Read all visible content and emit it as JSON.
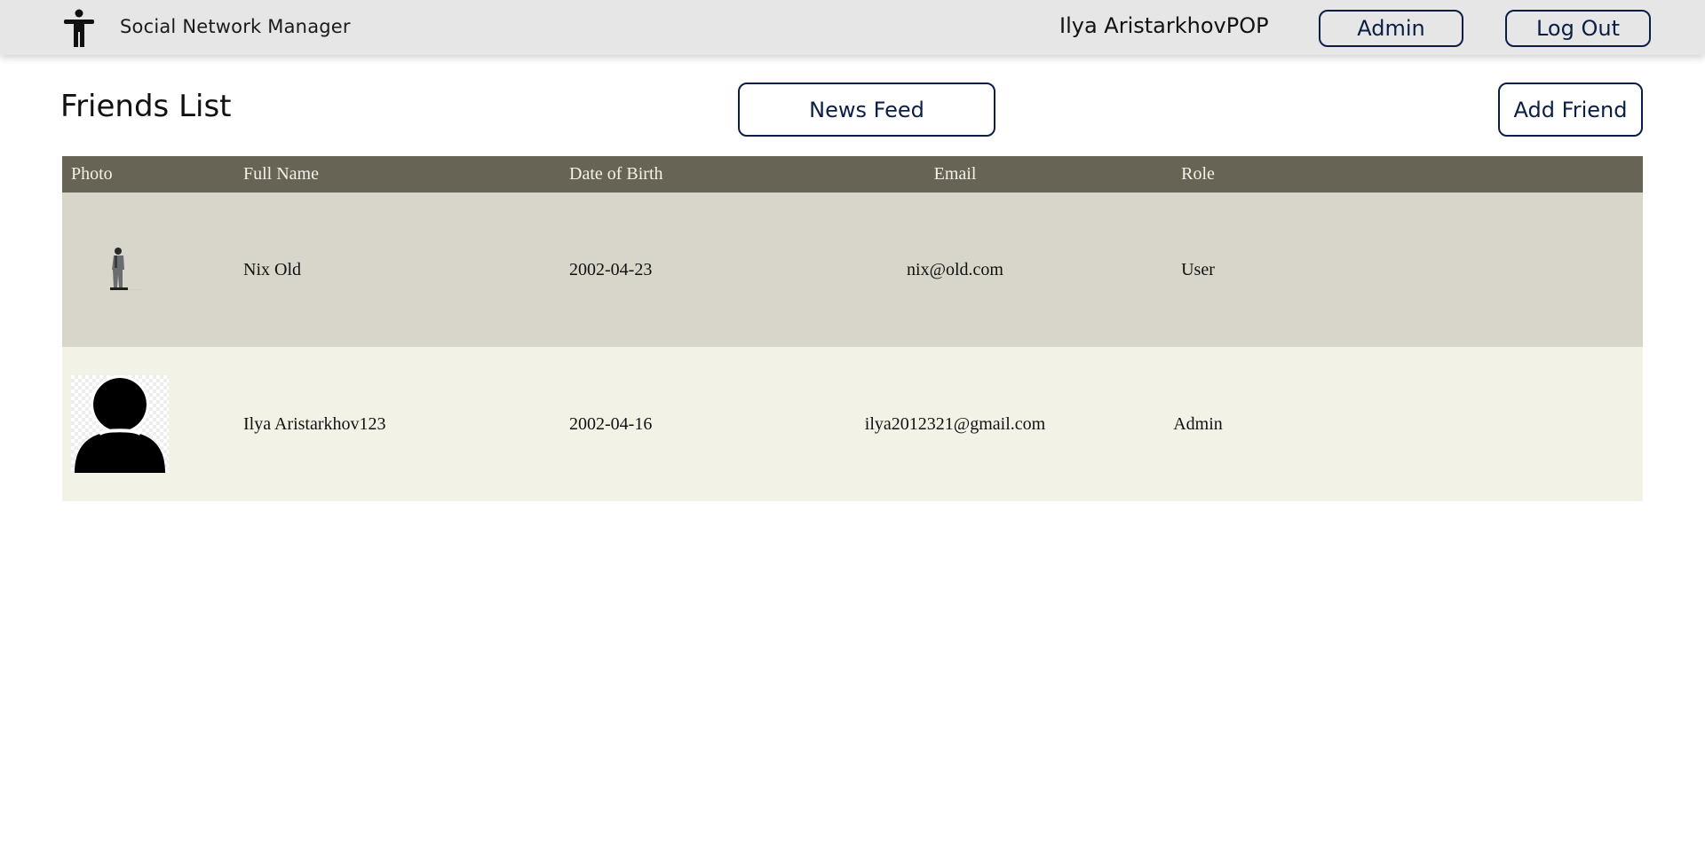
{
  "header": {
    "brand_title": "Social Network Manager",
    "brand_icon": "accessibility-person-icon",
    "user_name": "Ilya AristarkhovPOP",
    "admin_label": "Admin",
    "logout_label": "Log Out"
  },
  "page": {
    "title": "Friends List",
    "news_feed_label": "News Feed",
    "add_friend_label": "Add Friend"
  },
  "table": {
    "columns": [
      "Photo",
      "Full Name",
      "Date of Birth",
      "Email",
      "Role"
    ],
    "rows": [
      {
        "photo": "man-walking-photo",
        "full_name": "Nix Old",
        "dob": "2002-04-23",
        "email": "nix@old.com",
        "role": "User"
      },
      {
        "photo": "default-avatar-icon",
        "full_name": "Ilya Aristarkhov123",
        "dob": "2002-04-16",
        "email": "ilya2012321@gmail.com",
        "role": "Admin"
      }
    ]
  },
  "colors": {
    "header_bg": "#e6e6e6",
    "button_border": "#0b1e46",
    "table_head_bg": "#676455",
    "row_dark_bg": "#d8d6ca",
    "row_light_bg": "#f2f2e7"
  }
}
